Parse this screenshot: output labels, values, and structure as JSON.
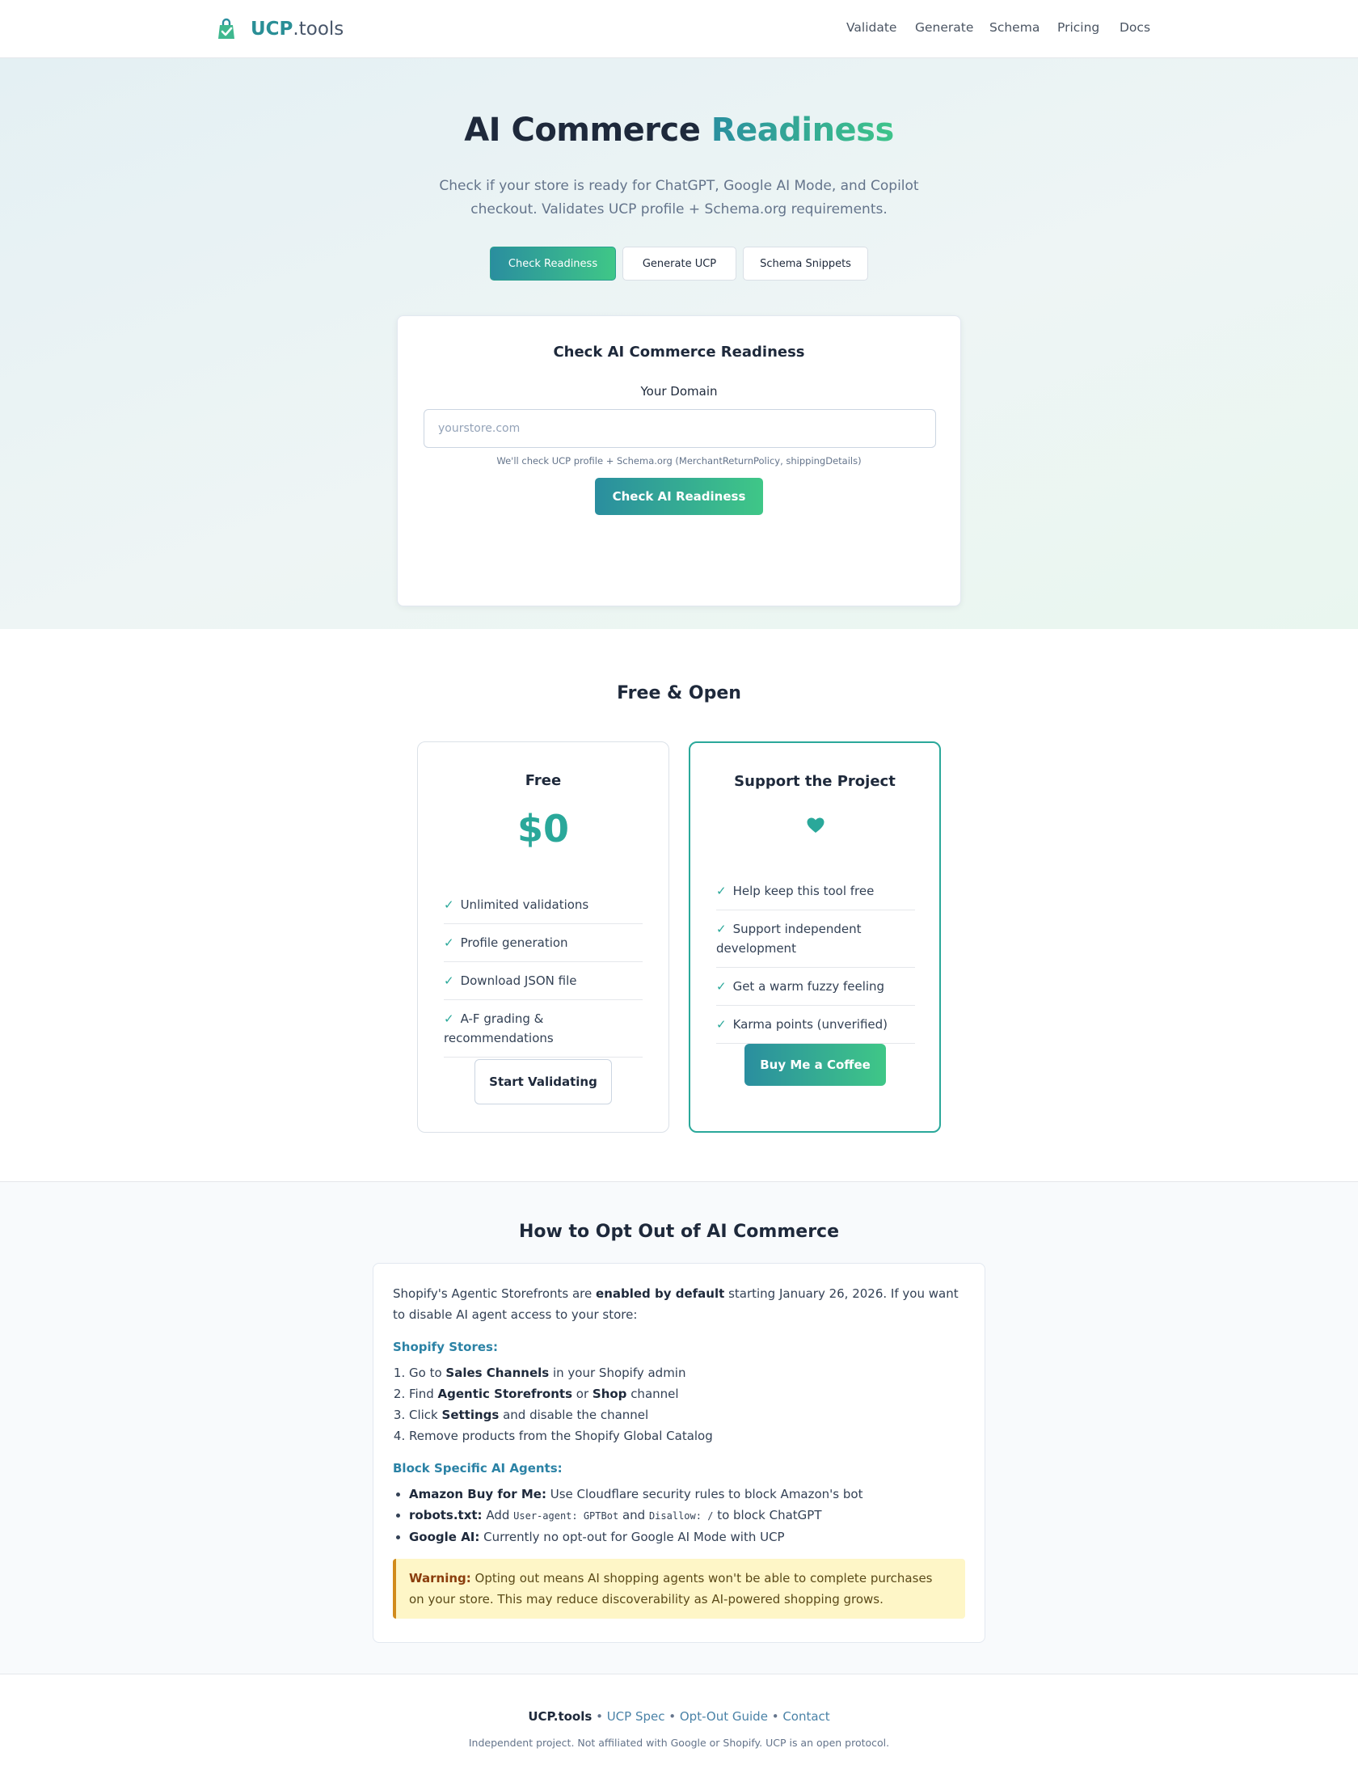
{
  "brand": {
    "name_bold": "UCP",
    "name_rest": ".tools"
  },
  "nav": [
    {
      "label": "Validate"
    },
    {
      "label": "Generate"
    },
    {
      "label": "Schema"
    },
    {
      "label": "Pricing"
    },
    {
      "label": "Docs"
    }
  ],
  "hero": {
    "title_main": "AI Commerce ",
    "title_accent": "Readiness",
    "subtitle": "Check if your store is ready for ChatGPT, Google AI Mode, and Copilot checkout. Validates UCP profile + Schema.org requirements.",
    "tabs": [
      {
        "label": "Check Readiness",
        "active": true
      },
      {
        "label": "Generate UCP",
        "active": false
      },
      {
        "label": "Schema Snippets",
        "active": false
      }
    ]
  },
  "check_card": {
    "title": "Check AI Commerce Readiness",
    "field_label": "Your Domain",
    "input_value": "",
    "input_placeholder": "yourstore.com",
    "hint": "We'll check UCP profile + Schema.org (MerchantReturnPolicy, shippingDetails)",
    "button": "Check AI Readiness"
  },
  "pricing": {
    "title": "Free & Open",
    "free": {
      "title": "Free",
      "price": "$0",
      "features": [
        "Unlimited validations",
        "Profile generation",
        "Download JSON file",
        "A-F grading & recommendations"
      ],
      "button": "Start Validating"
    },
    "support": {
      "title": "Support the Project",
      "icon": "heart-icon",
      "features": [
        "Help keep this tool free",
        "Support independent development",
        "Get a warm fuzzy feeling",
        "Karma points (unverified)"
      ],
      "button": "Buy Me a Coffee"
    }
  },
  "optout": {
    "title": "How to Opt Out of AI Commerce",
    "intro_1": "Shopify's Agentic Storefronts are ",
    "intro_bold": "enabled by default",
    "intro_2": " starting January 26, 2026. If you want to disable AI agent access to your store:",
    "shopify_heading": "Shopify Stores:",
    "steps": [
      {
        "a": "Go to ",
        "b": "Sales Channels",
        "c": " in your Shopify admin"
      },
      {
        "a": "Find ",
        "b": "Agentic Storefronts",
        "c": " or ",
        "d": "Shop",
        "e": " channel"
      },
      {
        "a": "Click ",
        "b": "Settings",
        "c": " and disable the channel"
      },
      {
        "a": "Remove products from the Shopify Global Catalog"
      }
    ],
    "agents_heading": "Block Specific AI Agents:",
    "agents": [
      {
        "name": "Amazon Buy for Me:",
        "text": " Use Cloudflare security rules to block Amazon's bot"
      },
      {
        "name": "robots.txt:",
        "t1": " Add ",
        "code1": "User-agent: GPTBot",
        "t2": " and ",
        "code2": "Disallow: /",
        "t3": " to block ChatGPT"
      },
      {
        "name": "Google AI:",
        "text": " Currently no opt-out for Google AI Mode with UCP"
      }
    ],
    "warning_label": "Warning:",
    "warning_text": " Opting out means AI shopping agents won't be able to complete purchases on your store. This may reduce discoverability as AI-powered shopping grows."
  },
  "footer": {
    "brand": "UCP.tools",
    "sep": " • ",
    "links": [
      "UCP Spec",
      "Opt-Out Guide",
      "Contact"
    ],
    "note": "Independent project. Not affiliated with Google or Shopify. UCP is an open protocol."
  },
  "colors": {
    "accent": "#2aa89a",
    "gradient_start": "#2a8e9f",
    "gradient_end": "#3fc787",
    "warning_bg": "#fef6c7"
  }
}
